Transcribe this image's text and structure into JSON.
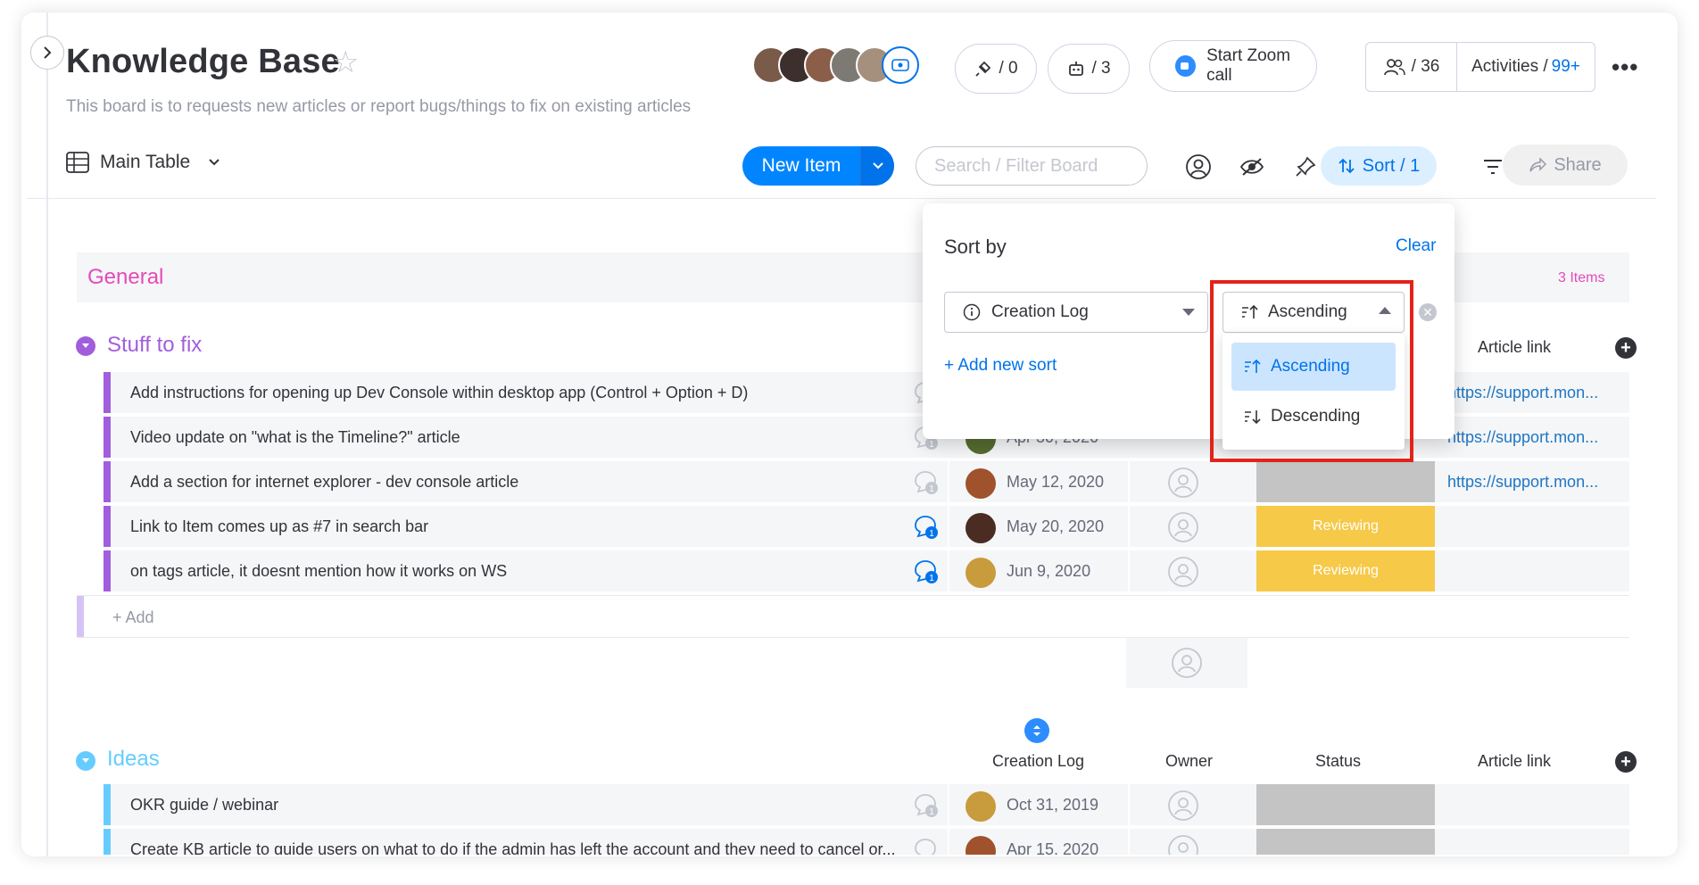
{
  "board": {
    "title": "Knowledge Base",
    "description": "This board is to requests new articles or report bugs/things to fix on existing articles"
  },
  "header": {
    "integrations_count": "/ 0",
    "automations_count": "/ 3",
    "zoom_label": "Start Zoom call",
    "members_count": "/ 36",
    "activities_label": "Activities /",
    "activities_count": "99+"
  },
  "toolbar": {
    "view_label": "Main Table",
    "new_item_label": "New Item",
    "search_placeholder": "Search / Filter Board",
    "sort_label": "Sort / 1",
    "share_label": "Share"
  },
  "sort_popup": {
    "title": "Sort by",
    "clear_label": "Clear",
    "column_value": "Creation Log",
    "direction_value": "Ascending",
    "add_sort_label": "+ Add new sort",
    "options": [
      "Ascending",
      "Descending"
    ]
  },
  "groups": {
    "general": {
      "label": "General",
      "count": "3 Items"
    },
    "stuff_to_fix": {
      "label": "Stuff to fix",
      "color": "#a25ddc",
      "article_col": "Article link",
      "rows": [
        {
          "name": "Add instructions for opening up Dev Console within desktop app (Control + Option + D)",
          "date": "",
          "status": "",
          "link": "https://support.mon..."
        },
        {
          "name": "Video update on \"what is the Timeline?\" article",
          "date": "Apr 30, 2020",
          "status": "",
          "link": "https://support.mon..."
        },
        {
          "name": "Add a section for internet explorer - dev console article",
          "date": "May 12, 2020",
          "status": "",
          "link": "https://support.mon..."
        },
        {
          "name": "Link to Item comes up as #7 in search bar",
          "date": "May 20, 2020",
          "status": "Reviewing",
          "link": ""
        },
        {
          "name": "on tags article, it doesnt mention how it works on WS",
          "date": "Jun 9, 2020",
          "status": "Reviewing",
          "link": ""
        }
      ],
      "add_label": "+ Add"
    },
    "ideas": {
      "label": "Ideas",
      "color": "#66ccff",
      "columns": [
        "Creation Log",
        "Owner",
        "Status",
        "Article link"
      ],
      "rows": [
        {
          "name": "OKR guide / webinar",
          "date": "Oct 31, 2019"
        },
        {
          "name": "Create KB article to guide users on what to do if the admin has left the account and they need to cancel or...",
          "date": "Apr 15, 2020"
        }
      ]
    }
  },
  "colors": {
    "primary": "#0073ea",
    "reviewing": "#f7c948",
    "grey_status": "#c4c4c4",
    "highlight": "#e2231a"
  }
}
